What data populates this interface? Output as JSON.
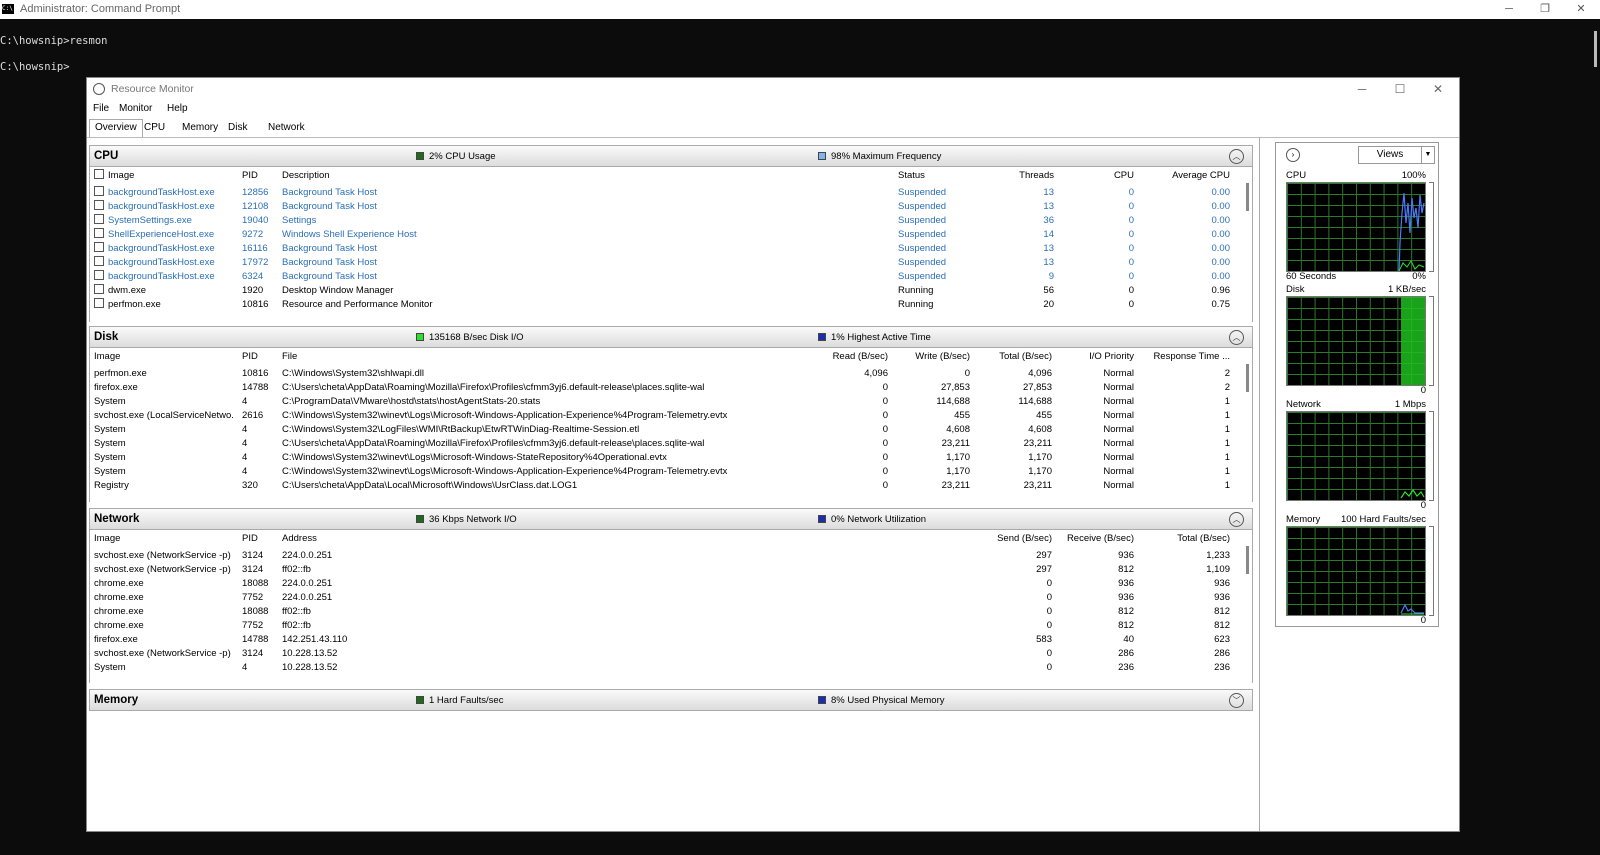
{
  "console": {
    "title": "Administrator: Command Prompt",
    "icon_text": "C:\\.",
    "lines": [
      "C:\\howsnip>resmon",
      "C:\\howsnip>"
    ]
  },
  "window": {
    "title": "Resource Monitor",
    "menu": [
      "File",
      "Monitor",
      "Help"
    ],
    "tabs": [
      "Overview",
      "CPU",
      "Memory",
      "Disk",
      "Network"
    ]
  },
  "colors": {
    "dark_green": "#1e6b1e",
    "bright_green": "#2ee02e",
    "light_blue": "#7fb4ee",
    "dark_blue": "#1a2fb0",
    "link_blue": "#2b6fb6"
  },
  "cpu": {
    "title": "CPU",
    "stat1": "2% CPU Usage",
    "stat2": "98% Maximum Frequency",
    "columns": [
      "Image",
      "PID",
      "Description",
      "Status",
      "Threads",
      "CPU",
      "Average CPU"
    ],
    "rows": [
      [
        "backgroundTaskHost.exe",
        "12856",
        "Background Task Host",
        "Suspended",
        "13",
        "0",
        "0.00"
      ],
      [
        "backgroundTaskHost.exe",
        "12108",
        "Background Task Host",
        "Suspended",
        "13",
        "0",
        "0.00"
      ],
      [
        "SystemSettings.exe",
        "19040",
        "Settings",
        "Suspended",
        "36",
        "0",
        "0.00"
      ],
      [
        "ShellExperienceHost.exe",
        "9272",
        "Windows Shell Experience Host",
        "Suspended",
        "14",
        "0",
        "0.00"
      ],
      [
        "backgroundTaskHost.exe",
        "16116",
        "Background Task Host",
        "Suspended",
        "13",
        "0",
        "0.00"
      ],
      [
        "backgroundTaskHost.exe",
        "17972",
        "Background Task Host",
        "Suspended",
        "13",
        "0",
        "0.00"
      ],
      [
        "backgroundTaskHost.exe",
        "6324",
        "Background Task Host",
        "Suspended",
        "9",
        "0",
        "0.00"
      ],
      [
        "dwm.exe",
        "1920",
        "Desktop Window Manager",
        "Running",
        "56",
        "0",
        "0.96"
      ],
      [
        "perfmon.exe",
        "10816",
        "Resource and Performance Monitor",
        "Running",
        "20",
        "0",
        "0.75"
      ]
    ]
  },
  "disk": {
    "title": "Disk",
    "stat1": "135168 B/sec Disk I/O",
    "stat2": "1% Highest Active Time",
    "columns": [
      "Image",
      "PID",
      "File",
      "Read (B/sec)",
      "Write (B/sec)",
      "Total (B/sec)",
      "I/O Priority",
      "Response Time ..."
    ],
    "rows": [
      [
        "perfmon.exe",
        "10816",
        "C:\\Windows\\System32\\shlwapi.dll",
        "4,096",
        "0",
        "4,096",
        "Normal",
        "2"
      ],
      [
        "firefox.exe",
        "14788",
        "C:\\Users\\cheta\\AppData\\Roaming\\Mozilla\\Firefox\\Profiles\\cfmm3yj6.default-release\\places.sqlite-wal",
        "0",
        "27,853",
        "27,853",
        "Normal",
        "2"
      ],
      [
        "System",
        "4",
        "C:\\ProgramData\\VMware\\hostd\\stats\\hostAgentStats-20.stats",
        "0",
        "114,688",
        "114,688",
        "Normal",
        "1"
      ],
      [
        "svchost.exe (LocalServiceNetwo...",
        "2616",
        "C:\\Windows\\System32\\winevt\\Logs\\Microsoft-Windows-Application-Experience%4Program-Telemetry.evtx",
        "0",
        "455",
        "455",
        "Normal",
        "1"
      ],
      [
        "System",
        "4",
        "C:\\Windows\\System32\\LogFiles\\WMI\\RtBackup\\EtwRTWinDiag-Realtime-Session.etl",
        "0",
        "4,608",
        "4,608",
        "Normal",
        "1"
      ],
      [
        "System",
        "4",
        "C:\\Users\\cheta\\AppData\\Roaming\\Mozilla\\Firefox\\Profiles\\cfmm3yj6.default-release\\places.sqlite-wal",
        "0",
        "23,211",
        "23,211",
        "Normal",
        "1"
      ],
      [
        "System",
        "4",
        "C:\\Windows\\System32\\winevt\\Logs\\Microsoft-Windows-StateRepository%4Operational.evtx",
        "0",
        "1,170",
        "1,170",
        "Normal",
        "1"
      ],
      [
        "System",
        "4",
        "C:\\Windows\\System32\\winevt\\Logs\\Microsoft-Windows-Application-Experience%4Program-Telemetry.evtx",
        "0",
        "1,170",
        "1,170",
        "Normal",
        "1"
      ],
      [
        "Registry",
        "320",
        "C:\\Users\\cheta\\AppData\\Local\\Microsoft\\Windows\\UsrClass.dat.LOG1",
        "0",
        "23,211",
        "23,211",
        "Normal",
        "1"
      ]
    ]
  },
  "network": {
    "title": "Network",
    "stat1": "36 Kbps Network I/O",
    "stat2": "0% Network Utilization",
    "columns": [
      "Image",
      "PID",
      "Address",
      "Send (B/sec)",
      "Receive (B/sec)",
      "Total (B/sec)"
    ],
    "rows": [
      [
        "svchost.exe (NetworkService -p)",
        "3124",
        "224.0.0.251",
        "297",
        "936",
        "1,233"
      ],
      [
        "svchost.exe (NetworkService -p)",
        "3124",
        "ff02::fb",
        "297",
        "812",
        "1,109"
      ],
      [
        "chrome.exe",
        "18088",
        "224.0.0.251",
        "0",
        "936",
        "936"
      ],
      [
        "chrome.exe",
        "7752",
        "224.0.0.251",
        "0",
        "936",
        "936"
      ],
      [
        "chrome.exe",
        "18088",
        "ff02::fb",
        "0",
        "812",
        "812"
      ],
      [
        "chrome.exe",
        "7752",
        "ff02::fb",
        "0",
        "812",
        "812"
      ],
      [
        "firefox.exe",
        "14788",
        "142.251.43.110",
        "583",
        "40",
        "623"
      ],
      [
        "svchost.exe (NetworkService -p)",
        "3124",
        "10.228.13.52",
        "0",
        "286",
        "286"
      ],
      [
        "System",
        "4",
        "10.228.13.52",
        "0",
        "236",
        "236"
      ]
    ]
  },
  "memory": {
    "title": "Memory",
    "stat1": "1 Hard Faults/sec",
    "stat2": "8% Used Physical Memory"
  },
  "side": {
    "views_label": "Views",
    "graphs": [
      {
        "name": "CPU",
        "max": "100%",
        "min_left": "60 Seconds",
        "min": "0%"
      },
      {
        "name": "Disk",
        "max": "1 KB/sec",
        "min_left": "",
        "min": "0"
      },
      {
        "name": "Network",
        "max": "1 Mbps",
        "min_left": "",
        "min": "0"
      },
      {
        "name": "Memory",
        "max": "100 Hard Faults/sec",
        "min_left": "",
        "min": "0"
      }
    ]
  }
}
